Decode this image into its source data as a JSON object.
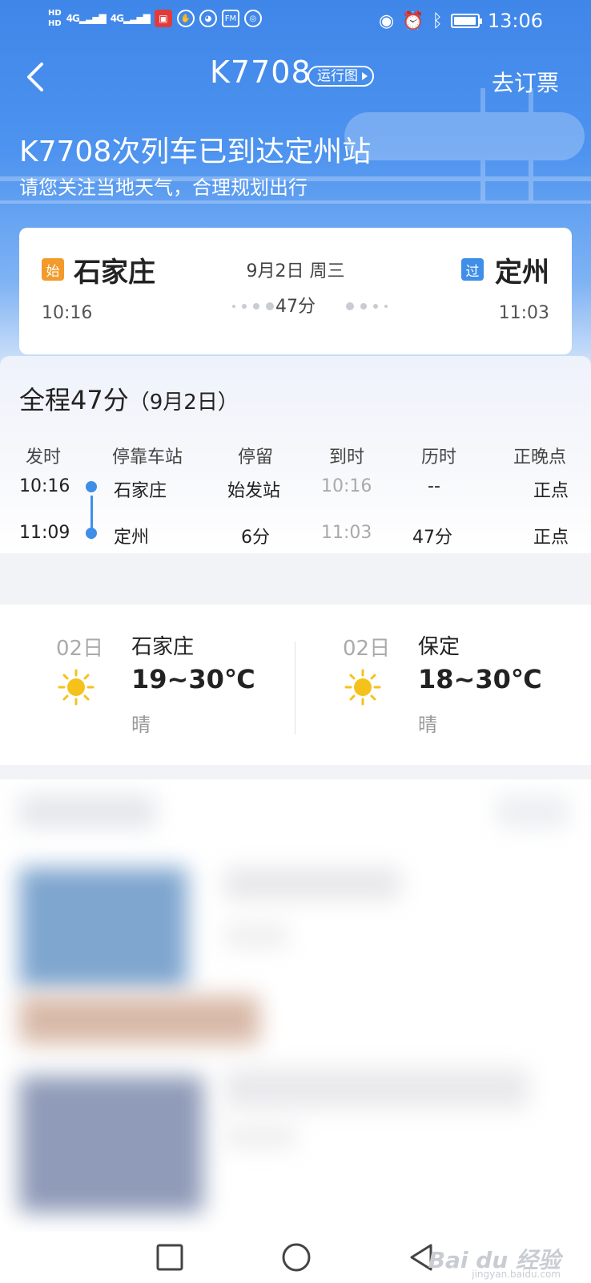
{
  "status_bar": {
    "hd1": "HD",
    "hd2": "HD",
    "net1": "4G",
    "net2": "4G",
    "time": "13:06"
  },
  "nav": {
    "title": "K7708",
    "map_label": "运行图",
    "book_label": "去订票"
  },
  "banner": {
    "headline": "K7708次列车已到达定州站",
    "subline": "请您关注当地天气，合理规划出行"
  },
  "trip": {
    "from_tag": "始",
    "from_station": "石家庄",
    "from_time": "10:16",
    "to_tag": "过",
    "to_station": "定州",
    "to_time": "11:03",
    "date": "9月2日 周三",
    "duration": "47分"
  },
  "schedule": {
    "title": "全程47分",
    "title_date": "（9月2日）",
    "headers": [
      "发时",
      "停靠车站",
      "停留",
      "到时",
      "历时",
      "正晚点"
    ],
    "rows": [
      {
        "depart": "10:16",
        "station": "石家庄",
        "stay": "始发站",
        "arrive": "10:16",
        "elapsed": "--",
        "status": "正点"
      },
      {
        "depart": "11:09",
        "station": "定州",
        "stay": "6分",
        "arrive": "11:03",
        "elapsed": "47分",
        "status": "正点"
      }
    ]
  },
  "weather": [
    {
      "day": "02日",
      "city": "石家庄",
      "temp": "19~30℃",
      "cond": "晴",
      "icon": "sun-icon"
    },
    {
      "day": "02日",
      "city": "保定",
      "temp": "18~30℃",
      "cond": "晴",
      "icon": "sun-icon"
    }
  ],
  "watermark": {
    "text": "Bai du 经验",
    "sub": "jingyan.baidu.com"
  },
  "colors": {
    "header_blue": "#3f86e9",
    "accent_blue": "#3f8fe8",
    "start_tag": "#f39a2b",
    "sun": "#f5c21b"
  }
}
